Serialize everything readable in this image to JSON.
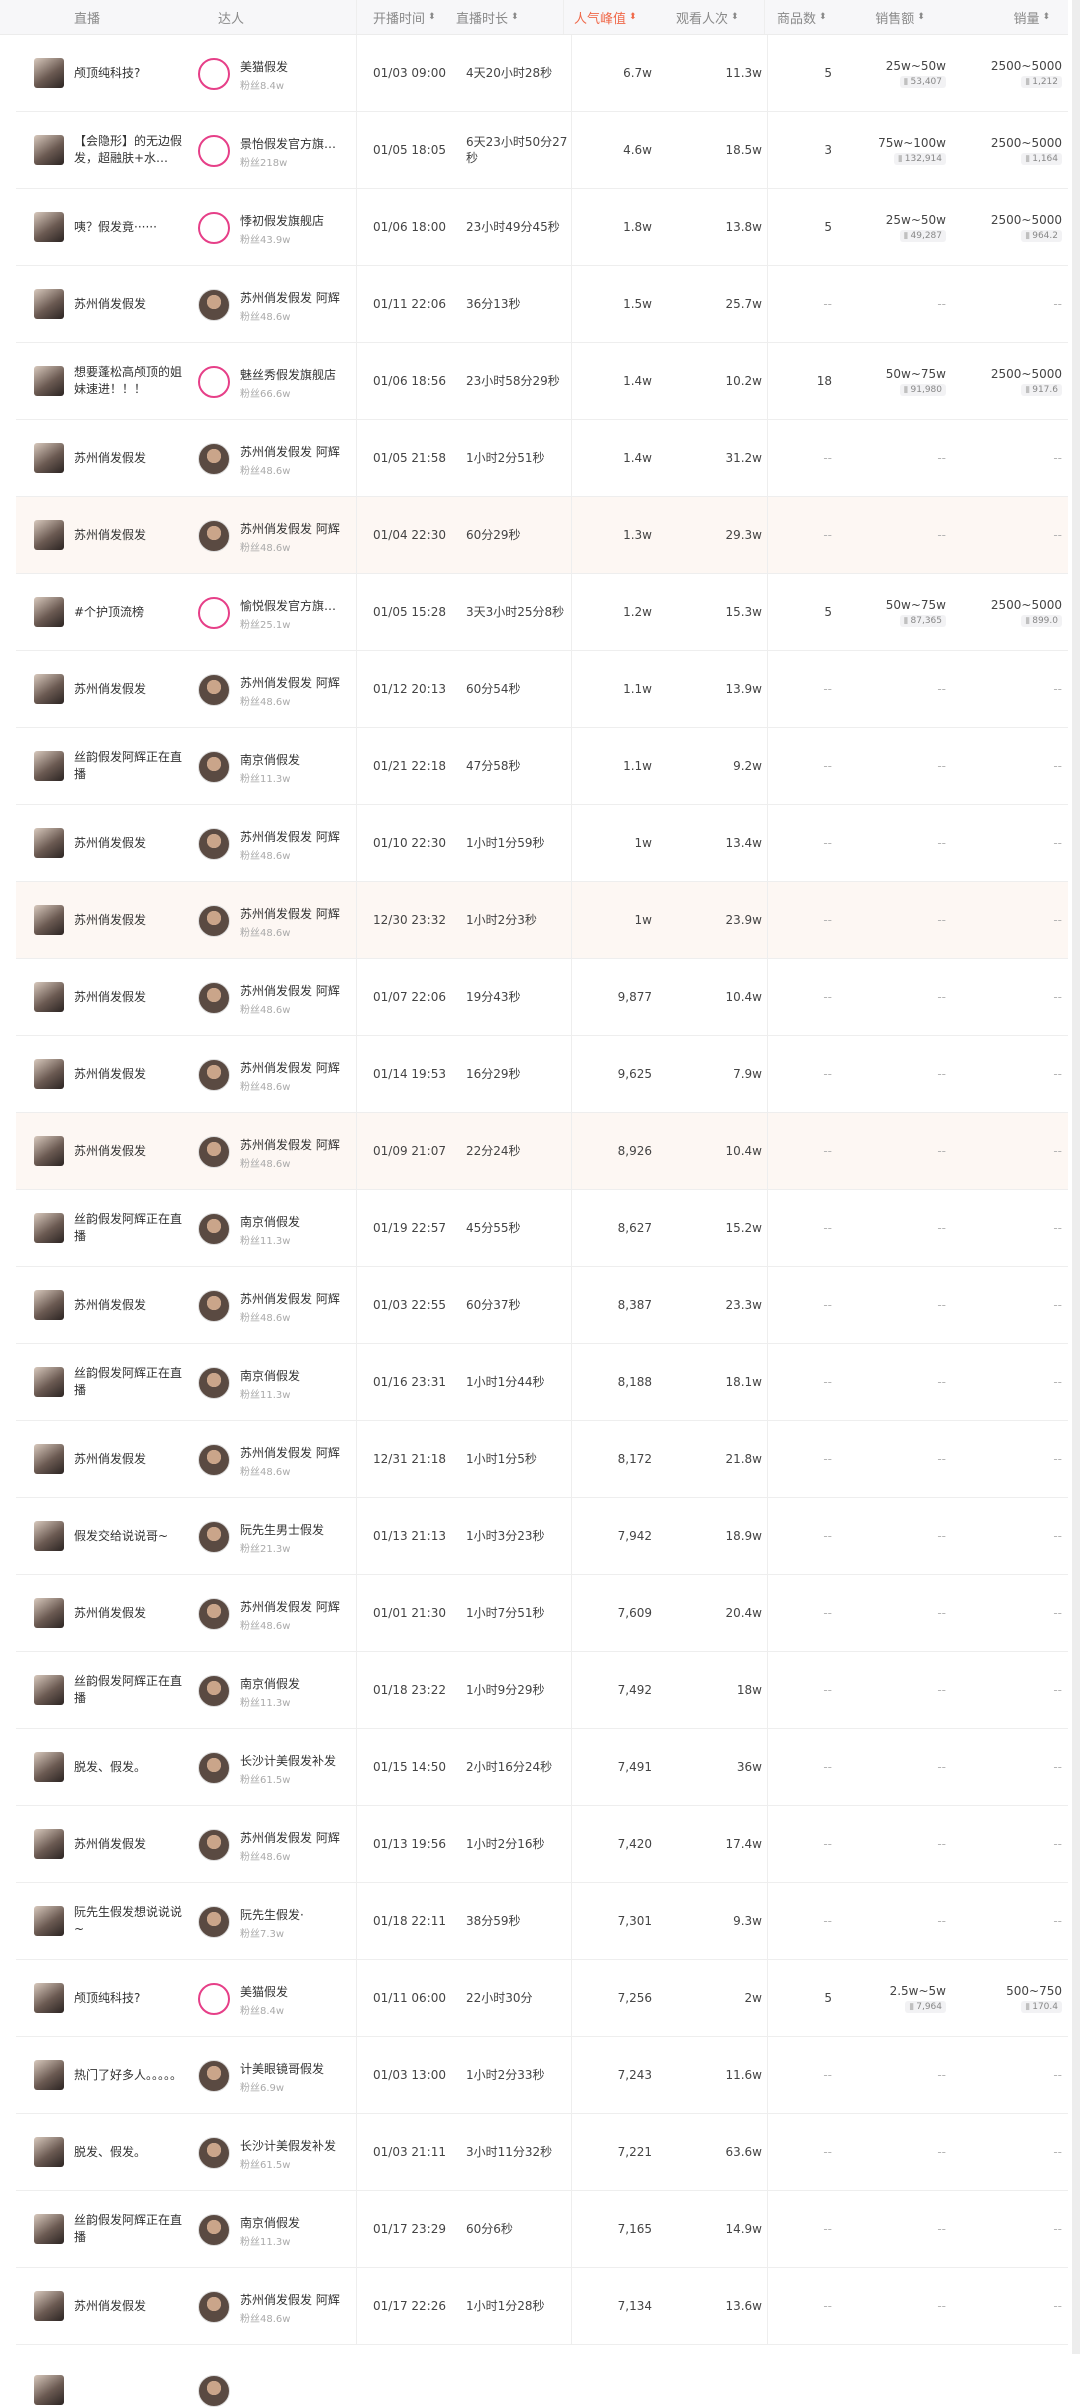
{
  "header": {
    "c1": "直播",
    "c2": "达人",
    "c3": "开播时间",
    "c4": "直播时长",
    "c5": "人气峰值",
    "c6": "观看人次",
    "c7": "商品数",
    "c8": "销售额",
    "c9": "销量"
  },
  "colors": {
    "accent": "#f06a4b",
    "row_highlight": "#fdf7f3"
  },
  "rows": [
    {
      "title": "颅顶纯科技?",
      "anchor": "美猫假发",
      "fans": "粉丝8.4w",
      "time": "01/03 09:00",
      "dur": "4天20小时28秒",
      "peak": "6.7w",
      "view": "11.3w",
      "goods": "5",
      "sales": "25w~50w",
      "sales_sub": "53,407",
      "vol": "2500~5000",
      "vol_sub": "1,212",
      "hl": false,
      "pink": true
    },
    {
      "title": "【会隐形】的无边假发，超融肤+水…",
      "anchor": "景怡假发官方旗…",
      "fans": "粉丝218w",
      "time": "01/05 18:05",
      "dur": "6天23小时50分27秒",
      "peak": "4.6w",
      "view": "18.5w",
      "goods": "3",
      "sales": "75w~100w",
      "sales_sub": "132,914",
      "vol": "2500~5000",
      "vol_sub": "1,164",
      "hl": false,
      "pink": true
    },
    {
      "title": "咦？假发竟······",
      "anchor": "悸初假发旗舰店",
      "fans": "粉丝43.9w",
      "time": "01/06 18:00",
      "dur": "23小时49分45秒",
      "peak": "1.8w",
      "view": "13.8w",
      "goods": "5",
      "sales": "25w~50w",
      "sales_sub": "49,287",
      "vol": "2500~5000",
      "vol_sub": "964.2",
      "hl": false,
      "pink": true
    },
    {
      "title": "苏州俏发假发",
      "anchor": "苏州俏发假发 阿辉",
      "fans": "粉丝48.6w",
      "time": "01/11 22:06",
      "dur": "36分13秒",
      "peak": "1.5w",
      "view": "25.7w",
      "goods": "--",
      "sales": "--",
      "sales_sub": "",
      "vol": "--",
      "vol_sub": "",
      "hl": false,
      "pink": false
    },
    {
      "title": "想要蓬松高颅顶的姐妹速进！！！",
      "anchor": "魅丝秀假发旗舰店",
      "fans": "粉丝66.6w",
      "time": "01/06 18:56",
      "dur": "23小时58分29秒",
      "peak": "1.4w",
      "view": "10.2w",
      "goods": "18",
      "sales": "50w~75w",
      "sales_sub": "91,980",
      "vol": "2500~5000",
      "vol_sub": "917.6",
      "hl": false,
      "pink": true
    },
    {
      "title": "苏州俏发假发",
      "anchor": "苏州俏发假发 阿辉",
      "fans": "粉丝48.6w",
      "time": "01/05 21:58",
      "dur": "1小时2分51秒",
      "peak": "1.4w",
      "view": "31.2w",
      "goods": "--",
      "sales": "--",
      "sales_sub": "",
      "vol": "--",
      "vol_sub": "",
      "hl": false,
      "pink": false
    },
    {
      "title": "苏州俏发假发",
      "anchor": "苏州俏发假发 阿辉",
      "fans": "粉丝48.6w",
      "time": "01/04 22:30",
      "dur": "60分29秒",
      "peak": "1.3w",
      "view": "29.3w",
      "goods": "--",
      "sales": "--",
      "sales_sub": "",
      "vol": "--",
      "vol_sub": "",
      "hl": true,
      "pink": false
    },
    {
      "title": "#个护顶流榜",
      "anchor": "愉悦假发官方旗…",
      "fans": "粉丝25.1w",
      "time": "01/05 15:28",
      "dur": "3天3小时25分8秒",
      "peak": "1.2w",
      "view": "15.3w",
      "goods": "5",
      "sales": "50w~75w",
      "sales_sub": "87,365",
      "vol": "2500~5000",
      "vol_sub": "899.0",
      "hl": false,
      "pink": true
    },
    {
      "title": "苏州俏发假发",
      "anchor": "苏州俏发假发 阿辉",
      "fans": "粉丝48.6w",
      "time": "01/12 20:13",
      "dur": "60分54秒",
      "peak": "1.1w",
      "view": "13.9w",
      "goods": "--",
      "sales": "--",
      "sales_sub": "",
      "vol": "--",
      "vol_sub": "",
      "hl": false,
      "pink": false
    },
    {
      "title": "丝韵假发阿辉正在直播",
      "anchor": "南京俏假发",
      "fans": "粉丝11.3w",
      "time": "01/21 22:18",
      "dur": "47分58秒",
      "peak": "1.1w",
      "view": "9.2w",
      "goods": "--",
      "sales": "--",
      "sales_sub": "",
      "vol": "--",
      "vol_sub": "",
      "hl": false,
      "pink": false
    },
    {
      "title": "苏州俏发假发",
      "anchor": "苏州俏发假发 阿辉",
      "fans": "粉丝48.6w",
      "time": "01/10 22:30",
      "dur": "1小时1分59秒",
      "peak": "1w",
      "view": "13.4w",
      "goods": "--",
      "sales": "--",
      "sales_sub": "",
      "vol": "--",
      "vol_sub": "",
      "hl": false,
      "pink": false
    },
    {
      "title": "苏州俏发假发",
      "anchor": "苏州俏发假发 阿辉",
      "fans": "粉丝48.6w",
      "time": "12/30 23:32",
      "dur": "1小时2分3秒",
      "peak": "1w",
      "view": "23.9w",
      "goods": "--",
      "sales": "--",
      "sales_sub": "",
      "vol": "--",
      "vol_sub": "",
      "hl": true,
      "pink": false
    },
    {
      "title": "苏州俏发假发",
      "anchor": "苏州俏发假发 阿辉",
      "fans": "粉丝48.6w",
      "time": "01/07 22:06",
      "dur": "19分43秒",
      "peak": "9,877",
      "view": "10.4w",
      "goods": "--",
      "sales": "--",
      "sales_sub": "",
      "vol": "--",
      "vol_sub": "",
      "hl": false,
      "pink": false
    },
    {
      "title": "苏州俏发假发",
      "anchor": "苏州俏发假发 阿辉",
      "fans": "粉丝48.6w",
      "time": "01/14 19:53",
      "dur": "16分29秒",
      "peak": "9,625",
      "view": "7.9w",
      "goods": "--",
      "sales": "--",
      "sales_sub": "",
      "vol": "--",
      "vol_sub": "",
      "hl": false,
      "pink": false
    },
    {
      "title": "苏州俏发假发",
      "anchor": "苏州俏发假发 阿辉",
      "fans": "粉丝48.6w",
      "time": "01/09 21:07",
      "dur": "22分24秒",
      "peak": "8,926",
      "view": "10.4w",
      "goods": "--",
      "sales": "--",
      "sales_sub": "",
      "vol": "--",
      "vol_sub": "",
      "hl": true,
      "pink": false
    },
    {
      "title": "丝韵假发阿辉正在直播",
      "anchor": "南京俏假发",
      "fans": "粉丝11.3w",
      "time": "01/19 22:57",
      "dur": "45分55秒",
      "peak": "8,627",
      "view": "15.2w",
      "goods": "--",
      "sales": "--",
      "sales_sub": "",
      "vol": "--",
      "vol_sub": "",
      "hl": false,
      "pink": false
    },
    {
      "title": "苏州俏发假发",
      "anchor": "苏州俏发假发 阿辉",
      "fans": "粉丝48.6w",
      "time": "01/03 22:55",
      "dur": "60分37秒",
      "peak": "8,387",
      "view": "23.3w",
      "goods": "--",
      "sales": "--",
      "sales_sub": "",
      "vol": "--",
      "vol_sub": "",
      "hl": false,
      "pink": false
    },
    {
      "title": "丝韵假发阿辉正在直播",
      "anchor": "南京俏假发",
      "fans": "粉丝11.3w",
      "time": "01/16 23:31",
      "dur": "1小时1分44秒",
      "peak": "8,188",
      "view": "18.1w",
      "goods": "--",
      "sales": "--",
      "sales_sub": "",
      "vol": "--",
      "vol_sub": "",
      "hl": false,
      "pink": false
    },
    {
      "title": "苏州俏发假发",
      "anchor": "苏州俏发假发 阿辉",
      "fans": "粉丝48.6w",
      "time": "12/31 21:18",
      "dur": "1小时1分5秒",
      "peak": "8,172",
      "view": "21.8w",
      "goods": "--",
      "sales": "--",
      "sales_sub": "",
      "vol": "--",
      "vol_sub": "",
      "hl": false,
      "pink": false
    },
    {
      "title": "假发交给说说哥~",
      "anchor": "阮先生男士假发",
      "fans": "粉丝21.3w",
      "time": "01/13 21:13",
      "dur": "1小时3分23秒",
      "peak": "7,942",
      "view": "18.9w",
      "goods": "--",
      "sales": "--",
      "sales_sub": "",
      "vol": "--",
      "vol_sub": "",
      "hl": false,
      "pink": false
    },
    {
      "title": "苏州俏发假发",
      "anchor": "苏州俏发假发 阿辉",
      "fans": "粉丝48.6w",
      "time": "01/01 21:30",
      "dur": "1小时7分51秒",
      "peak": "7,609",
      "view": "20.4w",
      "goods": "--",
      "sales": "--",
      "sales_sub": "",
      "vol": "--",
      "vol_sub": "",
      "hl": false,
      "pink": false
    },
    {
      "title": "丝韵假发阿辉正在直播",
      "anchor": "南京俏假发",
      "fans": "粉丝11.3w",
      "time": "01/18 23:22",
      "dur": "1小时9分29秒",
      "peak": "7,492",
      "view": "18w",
      "goods": "--",
      "sales": "--",
      "sales_sub": "",
      "vol": "--",
      "vol_sub": "",
      "hl": false,
      "pink": false
    },
    {
      "title": "脱发、假发。",
      "anchor": "长沙计美假发补发",
      "fans": "粉丝61.5w",
      "time": "01/15 14:50",
      "dur": "2小时16分24秒",
      "peak": "7,491",
      "view": "36w",
      "goods": "--",
      "sales": "--",
      "sales_sub": "",
      "vol": "--",
      "vol_sub": "",
      "hl": false,
      "pink": false
    },
    {
      "title": "苏州俏发假发",
      "anchor": "苏州俏发假发 阿辉",
      "fans": "粉丝48.6w",
      "time": "01/13 19:56",
      "dur": "1小时2分16秒",
      "peak": "7,420",
      "view": "17.4w",
      "goods": "--",
      "sales": "--",
      "sales_sub": "",
      "vol": "--",
      "vol_sub": "",
      "hl": false,
      "pink": false
    },
    {
      "title": "阮先生假发想说说说~",
      "anchor": "阮先生假发·",
      "fans": "粉丝7.3w",
      "time": "01/18 22:11",
      "dur": "38分59秒",
      "peak": "7,301",
      "view": "9.3w",
      "goods": "--",
      "sales": "--",
      "sales_sub": "",
      "vol": "--",
      "vol_sub": "",
      "hl": false,
      "pink": false
    },
    {
      "title": "颅顶纯科技?",
      "anchor": "美猫假发",
      "fans": "粉丝8.4w",
      "time": "01/11 06:00",
      "dur": "22小时30分",
      "peak": "7,256",
      "view": "2w",
      "goods": "5",
      "sales": "2.5w~5w",
      "sales_sub": "7,964",
      "vol": "500~750",
      "vol_sub": "170.4",
      "hl": false,
      "pink": true
    },
    {
      "title": "热门了好多人。。。。。",
      "anchor": "计美眼镜哥假发",
      "fans": "粉丝6.9w",
      "time": "01/03 13:00",
      "dur": "1小时2分33秒",
      "peak": "7,243",
      "view": "11.6w",
      "goods": "--",
      "sales": "--",
      "sales_sub": "",
      "vol": "--",
      "vol_sub": "",
      "hl": false,
      "pink": false
    },
    {
      "title": "脱发、假发。",
      "anchor": "长沙计美假发补发",
      "fans": "粉丝61.5w",
      "time": "01/03 21:11",
      "dur": "3小时11分32秒",
      "peak": "7,221",
      "view": "63.6w",
      "goods": "--",
      "sales": "--",
      "sales_sub": "",
      "vol": "--",
      "vol_sub": "",
      "hl": false,
      "pink": false
    },
    {
      "title": "丝韵假发阿辉正在直播",
      "anchor": "南京俏假发",
      "fans": "粉丝11.3w",
      "time": "01/17 23:29",
      "dur": "60分6秒",
      "peak": "7,165",
      "view": "14.9w",
      "goods": "--",
      "sales": "--",
      "sales_sub": "",
      "vol": "--",
      "vol_sub": "",
      "hl": false,
      "pink": false
    },
    {
      "title": "苏州俏发假发",
      "anchor": "苏州俏发假发 阿辉",
      "fans": "粉丝48.6w",
      "time": "01/17 22:26",
      "dur": "1小时1分28秒",
      "peak": "7,134",
      "view": "13.6w",
      "goods": "--",
      "sales": "--",
      "sales_sub": "",
      "vol": "--",
      "vol_sub": "",
      "hl": false,
      "pink": false
    }
  ]
}
